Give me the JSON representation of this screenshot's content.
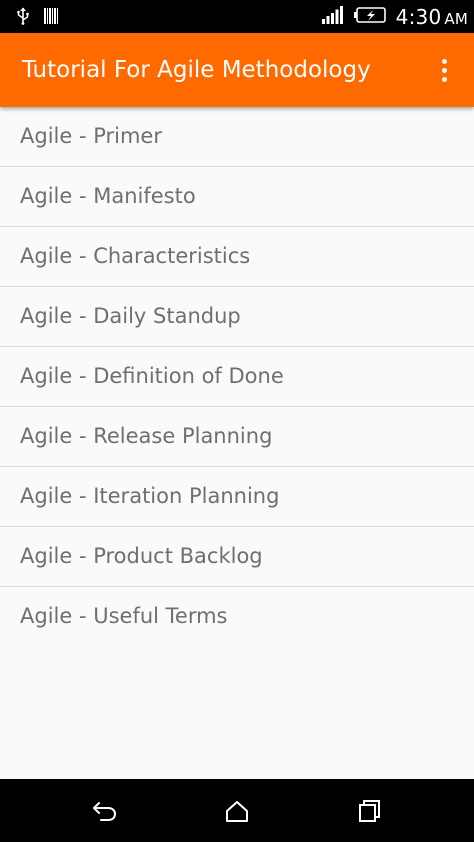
{
  "status_bar": {
    "time": "4:30",
    "ampm": "AM",
    "icons": [
      "usb-icon",
      "barcode-icon",
      "signal-icon",
      "battery-charging-icon"
    ]
  },
  "app_bar": {
    "title": "Tutorial For Agile Methodology",
    "menu_icon": "overflow-menu-icon",
    "background_color": "#FF6A00"
  },
  "list": {
    "items": [
      {
        "label": "Agile - Primer"
      },
      {
        "label": "Agile - Manifesto"
      },
      {
        "label": "Agile - Characteristics"
      },
      {
        "label": "Agile - Daily Standup"
      },
      {
        "label": "Agile - Definition of Done"
      },
      {
        "label": "Agile - Release Planning"
      },
      {
        "label": "Agile - Iteration Planning"
      },
      {
        "label": "Agile - Product Backlog"
      },
      {
        "label": "Agile - Useful Terms"
      }
    ]
  },
  "nav_bar": {
    "buttons": [
      "back-icon",
      "home-icon",
      "recents-icon"
    ]
  }
}
